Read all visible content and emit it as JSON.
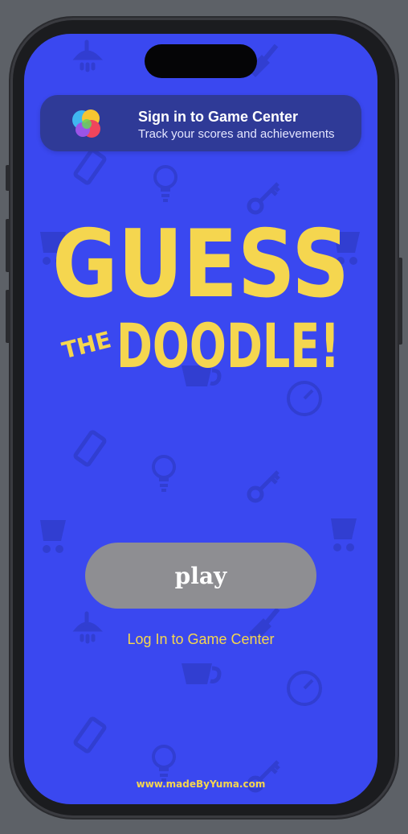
{
  "banner": {
    "title": "Sign in to Game Center",
    "subtitle": "Track your scores and achievements"
  },
  "game": {
    "title_line1": "GUESS",
    "title_prefix": "THE",
    "title_line2": "DOODLE!",
    "play_label": "play",
    "login_label": "Log In to Game Center",
    "footer": "www.madeByYuma.com"
  },
  "colors": {
    "background": "#3a48f0",
    "title_yellow": "#f5d64f",
    "play_button": "#8e8e92",
    "banner": "#2f3a97"
  },
  "icons": [
    "shower-icon",
    "trowel-icon",
    "phone-icon",
    "lightbulb-icon",
    "key-icon",
    "cart-icon",
    "teacup-icon",
    "gauge-icon"
  ]
}
